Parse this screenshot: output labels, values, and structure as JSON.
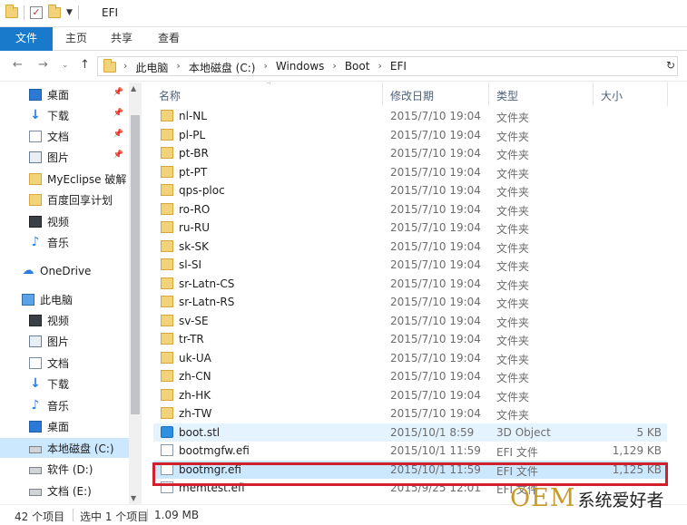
{
  "window": {
    "title": "EFI"
  },
  "ribbon": {
    "tabs": [
      "文件",
      "主页",
      "共享",
      "查看"
    ]
  },
  "address": {
    "crumbs": [
      "此电脑",
      "本地磁盘 (C:)",
      "Windows",
      "Boot",
      "EFI"
    ]
  },
  "sidebar": {
    "items": [
      {
        "label": "桌面",
        "icon": "desktop-icon",
        "pinned": true
      },
      {
        "label": "下载",
        "icon": "download-icon",
        "pinned": true
      },
      {
        "label": "文档",
        "icon": "document-icon",
        "pinned": true
      },
      {
        "label": "图片",
        "icon": "pictures-icon",
        "pinned": true
      },
      {
        "label": "MyEclipse 破解",
        "icon": "folder-icon",
        "pinned": false
      },
      {
        "label": "百度回享计划",
        "icon": "folder-icon",
        "pinned": false
      },
      {
        "label": "视频",
        "icon": "video-icon",
        "pinned": false
      },
      {
        "label": "音乐",
        "icon": "music-icon",
        "pinned": false
      },
      {
        "label": "OneDrive",
        "icon": "onedrive-icon",
        "pinned": false
      },
      {
        "label": "此电脑",
        "icon": "this-pc-icon",
        "pinned": false
      },
      {
        "label": "视频",
        "icon": "video-icon",
        "pinned": false
      },
      {
        "label": "图片",
        "icon": "pictures-icon",
        "pinned": false
      },
      {
        "label": "文档",
        "icon": "document-icon",
        "pinned": false
      },
      {
        "label": "下载",
        "icon": "download-icon",
        "pinned": false
      },
      {
        "label": "音乐",
        "icon": "music-icon",
        "pinned": false
      },
      {
        "label": "桌面",
        "icon": "desktop-icon",
        "pinned": false
      },
      {
        "label": "本地磁盘 (C:)",
        "icon": "drive-icon",
        "pinned": false,
        "selected": true
      },
      {
        "label": "软件 (D:)",
        "icon": "drive-icon",
        "pinned": false
      },
      {
        "label": "文档 (E:)",
        "icon": "drive-icon",
        "pinned": false
      }
    ]
  },
  "columns": {
    "name": "名称",
    "date": "修改日期",
    "type": "类型",
    "size": "大小"
  },
  "files": [
    {
      "name": "nl-NL",
      "date": "2015/7/10 19:04",
      "type": "文件夹",
      "size": "",
      "kind": "folder"
    },
    {
      "name": "pl-PL",
      "date": "2015/7/10 19:04",
      "type": "文件夹",
      "size": "",
      "kind": "folder"
    },
    {
      "name": "pt-BR",
      "date": "2015/7/10 19:04",
      "type": "文件夹",
      "size": "",
      "kind": "folder"
    },
    {
      "name": "pt-PT",
      "date": "2015/7/10 19:04",
      "type": "文件夹",
      "size": "",
      "kind": "folder"
    },
    {
      "name": "qps-ploc",
      "date": "2015/7/10 19:04",
      "type": "文件夹",
      "size": "",
      "kind": "folder"
    },
    {
      "name": "ro-RO",
      "date": "2015/7/10 19:04",
      "type": "文件夹",
      "size": "",
      "kind": "folder"
    },
    {
      "name": "ru-RU",
      "date": "2015/7/10 19:04",
      "type": "文件夹",
      "size": "",
      "kind": "folder"
    },
    {
      "name": "sk-SK",
      "date": "2015/7/10 19:04",
      "type": "文件夹",
      "size": "",
      "kind": "folder"
    },
    {
      "name": "sl-SI",
      "date": "2015/7/10 19:04",
      "type": "文件夹",
      "size": "",
      "kind": "folder"
    },
    {
      "name": "sr-Latn-CS",
      "date": "2015/7/10 19:04",
      "type": "文件夹",
      "size": "",
      "kind": "folder"
    },
    {
      "name": "sr-Latn-RS",
      "date": "2015/7/10 19:04",
      "type": "文件夹",
      "size": "",
      "kind": "folder"
    },
    {
      "name": "sv-SE",
      "date": "2015/7/10 19:04",
      "type": "文件夹",
      "size": "",
      "kind": "folder"
    },
    {
      "name": "tr-TR",
      "date": "2015/7/10 19:04",
      "type": "文件夹",
      "size": "",
      "kind": "folder"
    },
    {
      "name": "uk-UA",
      "date": "2015/7/10 19:04",
      "type": "文件夹",
      "size": "",
      "kind": "folder"
    },
    {
      "name": "zh-CN",
      "date": "2015/7/10 19:04",
      "type": "文件夹",
      "size": "",
      "kind": "folder"
    },
    {
      "name": "zh-HK",
      "date": "2015/7/10 19:04",
      "type": "文件夹",
      "size": "",
      "kind": "folder"
    },
    {
      "name": "zh-TW",
      "date": "2015/7/10 19:04",
      "type": "文件夹",
      "size": "",
      "kind": "folder"
    },
    {
      "name": "boot.stl",
      "date": "2015/10/1 8:59",
      "type": "3D Object",
      "size": "5 KB",
      "kind": "stl",
      "state": "hover"
    },
    {
      "name": "bootmgfw.efi",
      "date": "2015/10/1 11:59",
      "type": "EFI 文件",
      "size": "1,129 KB",
      "kind": "file"
    },
    {
      "name": "bootmgr.efi",
      "date": "2015/10/1 11:59",
      "type": "EFI 文件",
      "size": "1,125 KB",
      "kind": "file",
      "state": "selected"
    },
    {
      "name": "memtest.efi",
      "date": "2015/9/25 12:01",
      "type": "EFI 文件",
      "size": "",
      "kind": "file"
    }
  ],
  "status": {
    "item_count": "42 个项目",
    "selection": "选中 1 个项目",
    "selection_size": "1.09 MB"
  },
  "watermark": {
    "latin": "OEM",
    "cjk": "系统爱好者"
  },
  "colors": {
    "accent": "#1979ca",
    "selection": "#cce8ff",
    "hover": "#e5f3ff",
    "highlight_box": "#d21f2c",
    "folder": "#f3d37a"
  }
}
